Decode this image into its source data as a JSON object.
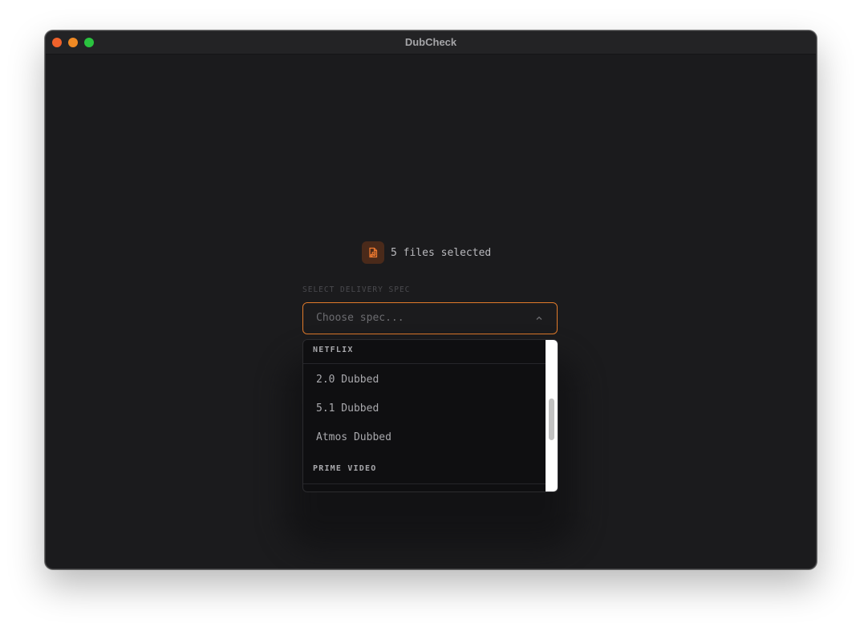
{
  "window": {
    "title": "DubCheck"
  },
  "files": {
    "icon": "audio-file-icon",
    "summary": "5 files selected"
  },
  "spec": {
    "label": "SELECT DELIVERY SPEC",
    "placeholder": "Choose spec...",
    "expanded": true
  },
  "dropdown": {
    "groups": [
      {
        "name": "NETFLIX",
        "options": [
          "2.0 Dubbed",
          "5.1 Dubbed",
          "Atmos Dubbed"
        ]
      },
      {
        "name": "PRIME VIDEO",
        "options": []
      }
    ]
  },
  "colors": {
    "accent": "#e07a2a",
    "background": "#1b1b1d",
    "dropdown_bg": "#0f0f11"
  }
}
